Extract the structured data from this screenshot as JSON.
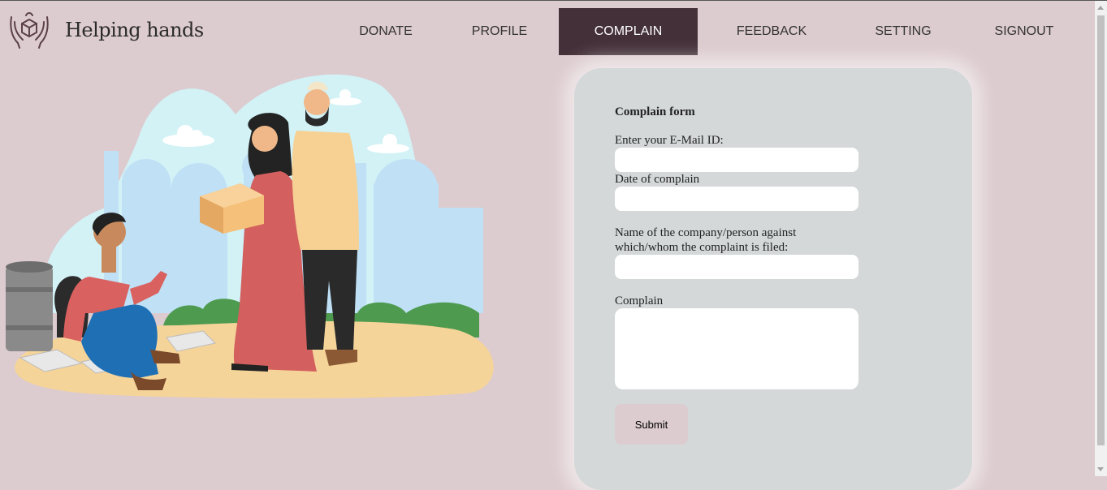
{
  "brand": {
    "name": "Helping hands",
    "logo_icon": "hands-with-box-icon"
  },
  "nav": {
    "items": [
      {
        "label": "DONATE"
      },
      {
        "label": "PROFILE"
      },
      {
        "label": "COMPLAIN",
        "active": true
      },
      {
        "label": "FEEDBACK"
      },
      {
        "label": "SETTING"
      },
      {
        "label": "SIGNOUT"
      }
    ]
  },
  "form": {
    "title": "Complain form",
    "email_label": "Enter your E-Mail ID:",
    "email_value": "",
    "date_label": "Date of complain",
    "date_value": "",
    "against_label": "Name of the company/person against which/whom the complaint is filed:",
    "against_value": "",
    "complain_label": "Complain",
    "complain_value": "",
    "submit_label": "Submit"
  },
  "colors": {
    "background": "#dccbcf",
    "nav_active": "#443039",
    "card": "#d4d8d9"
  }
}
